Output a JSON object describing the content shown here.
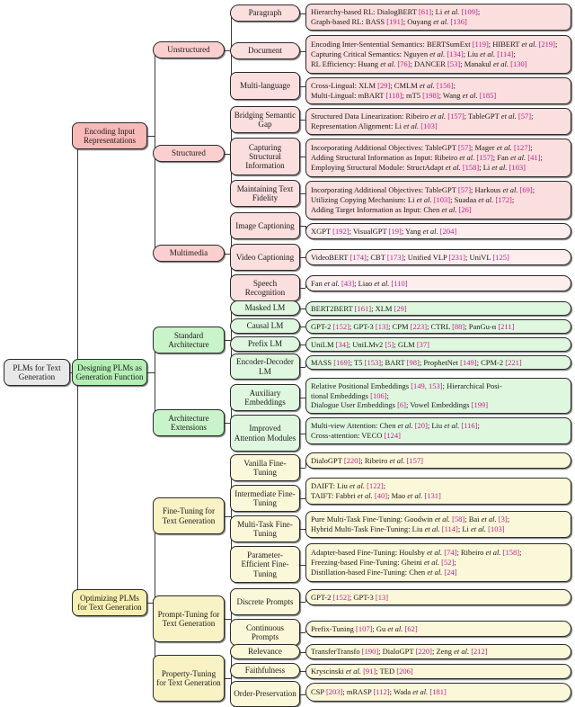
{
  "title": "PLMs for Text Generation taxonomy",
  "root": {
    "label": "PLMs for Text Generation"
  },
  "branches": [
    {
      "id": "encoding",
      "label": "Encoding Input Representations",
      "groups": [
        {
          "id": "unstructured",
          "label": "Unstructured",
          "items": [
            {
              "label": "Paragraph",
              "lines": [
                "Hierarchy-based RL: DialogBERT [61]; Li et al. [109];",
                "Graph-based RL: BASS [191]; Ouyang et al. [136]"
              ]
            },
            {
              "label": "Document",
              "lines": [
                "Encoding Inter-Sentential Semantics: BERTSumExt [119]; HIBERT et al. [219];",
                "Capturing Critical Semantics: Nguyen et al. [134]; Liu et al. [114];",
                "RL Efficiency: Huang et al. [76]; DANCER [53]; Manakul et al. [130]"
              ]
            },
            {
              "label": "Multi-language",
              "lines": [
                "Cross-Lingual: XLM [29]; CMLM et al. [156];",
                "Multi-Lingual: mBART [118]; mT5 [198]; Wang et al. [185]"
              ]
            }
          ]
        },
        {
          "id": "structured",
          "label": "Structured",
          "items": [
            {
              "label": "Bridging Semantic Gap",
              "lines": [
                "Structured Data Linearization: Ribeiro et al. [157]; TableGPT et al. [57];",
                "Representation Alignment: Li et al. [103]"
              ]
            },
            {
              "label": "Capturing Structural Information",
              "lines": [
                "Incorporating Additional Objectives: TableGPT [57]; Mager et al. [127];",
                "Adding Structural Information as Input: Ribeiro et al. [157]; Fan et al. [41];",
                "Employing Structural Module: StructAdapt et al. [158]; Li et al. [103]"
              ]
            },
            {
              "label": "Maintaining Text Fidelity",
              "lines": [
                "Incorporating Additional Objectives: TableGPT [57]; Harkous et al. [69];",
                "Utilizing Copying Mechanism: Li et al. [103]; Suadaa et al. [172];",
                "Adding Target Information as Input: Chen et al. [26]"
              ]
            }
          ]
        },
        {
          "id": "multimedia",
          "label": "Multimedia",
          "items": [
            {
              "label": "Image Captioning",
              "lines": [
                "XGPT [192]; VisualGPT [19]; Yang et al. [204]"
              ]
            },
            {
              "label": "Video Captioning",
              "lines": [
                "VideoBERT [174]; CBT [173]; Unified VLP [231]; UniVL [125]"
              ]
            },
            {
              "label": "Speech Recognition",
              "lines": [
                "Fan et al. [43]; Liao et al. [110]"
              ]
            }
          ]
        }
      ]
    },
    {
      "id": "designing",
      "label": "Designing PLMs as Generation Function",
      "groups": [
        {
          "id": "standard-architecture",
          "label": "Standard Architecture",
          "items": [
            {
              "label": "Masked LM",
              "lines": [
                "BERT2BERT [161]; XLM [29]"
              ]
            },
            {
              "label": "Causal LM",
              "lines": [
                "GPT-2 [152]; GPT-3 [13]; CPM [223]; CTRL [88]; PanGu-α [211]"
              ]
            },
            {
              "label": "Prefix LM",
              "lines": [
                "UniLM [34]; UniLMv2 [5]; GLM [37]"
              ]
            },
            {
              "label": "Encoder-Decoder LM",
              "lines": [
                "MASS [169]; T5 [153]; BART [98]; ProphetNet [149]; CPM-2 [221]"
              ]
            }
          ]
        },
        {
          "id": "architecture-extensions",
          "label": "Architecture Extensions",
          "items": [
            {
              "label": "Auxiliary Embeddings",
              "lines": [
                "Relative Positional Embeddings [149, 153]; Hierarchical Posi-",
                "tional Embeddings [106];",
                "Dialogue User Embeddings [6]; Vowel Embeddings [199]"
              ]
            },
            {
              "label": "Improved Attention Modules",
              "lines": [
                "Multi-view Attention: Chen et al. [20]; Liu et al. [116];",
                "Cross-attention: VECO [124]"
              ]
            }
          ]
        }
      ]
    },
    {
      "id": "optimizing",
      "label": "Optimizing PLMs for Text Generation",
      "groups": [
        {
          "id": "fine-tuning",
          "label": "Fine-Tuning for Text Generation",
          "items": [
            {
              "label": "Vanilla Fine-Tuning",
              "lines": [
                "DialoGPT [220]; Ribeiro et al. [157]"
              ]
            },
            {
              "label": "Intermediate Fine-Tuning",
              "lines": [
                "DAIFT: Liu et al. [122];",
                "TAIFT: Fabbri et al. [40]; Mao et al. [131]"
              ]
            },
            {
              "label": "Multi-Task Fine-Tuning",
              "lines": [
                "Pure Multi-Task Fine-Tuning: Goodwin et al. [58]; Bai et al. [3];",
                "Hybrid Multi-Task Fine-Tuning: Liu et al. [114]; Li et al. [103]"
              ]
            },
            {
              "label": "Parameter-Efficient Fine-Tuning",
              "lines": [
                "Adapter-based Fine-Tuning: Houlsby et al. [74]; Ribeiro et al. [158];",
                "Freezing-based Fine-Tuning: Gheini et al. [52];",
                "Distillation-based Fine-Tuning: Chen et al. [24]"
              ]
            }
          ]
        },
        {
          "id": "prompt-tuning",
          "label": "Prompt-Tuning for Text Generation",
          "items": [
            {
              "label": "Discrete Prompts",
              "lines": [
                "GPT-2 [152]; GPT-3 [13]"
              ]
            },
            {
              "label": "Continuous Prompts",
              "lines": [
                "Prefix-Tuning [107]; Gu et al. [62]"
              ]
            }
          ]
        },
        {
          "id": "property-tuning",
          "label": "Property-Tuning for Text Generation",
          "items": [
            {
              "label": "Relevance",
              "lines": [
                "TransferTransfo [190]; DialoGPT [220]; Zeng et al. [212]"
              ]
            },
            {
              "label": "Faithfulness",
              "lines": [
                "Kryscinski et al. [91]; TED [206]"
              ]
            },
            {
              "label": "Order-Preservation",
              "lines": [
                "CSP [203]; mRASP [112]; Wada et al. [181]"
              ]
            }
          ]
        }
      ]
    }
  ],
  "colors": {
    "root": "#e8e8e8",
    "branch_pink": "#f8b9b9",
    "branch_green": "#b4eeb4",
    "branch_yellow": "#f6efb0",
    "reference": "#c01f8c",
    "stroke": "#2b2b2b"
  }
}
